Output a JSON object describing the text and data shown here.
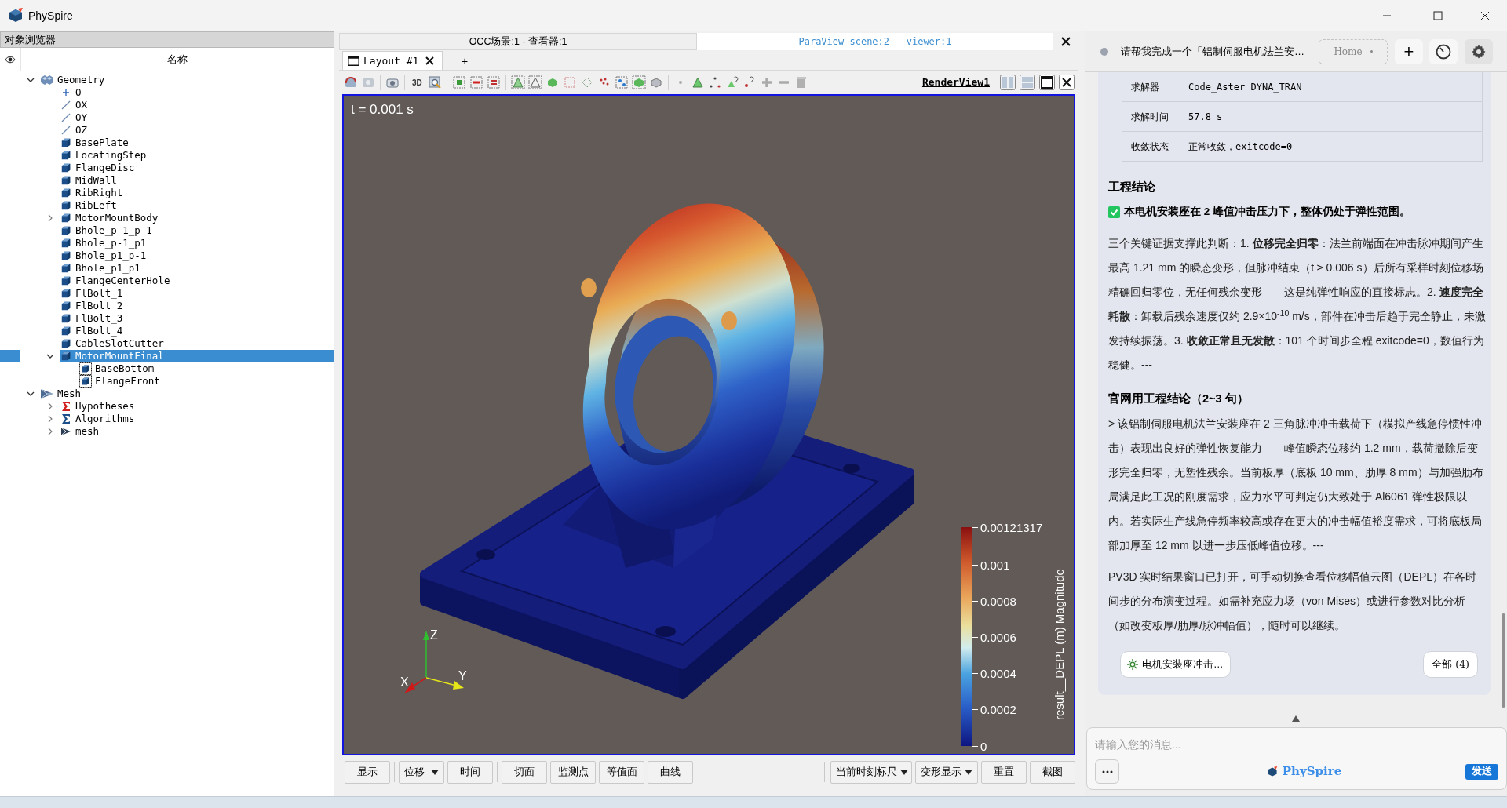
{
  "window": {
    "title": "PhySpire"
  },
  "object_browser": {
    "title": "对象浏览器",
    "column": "名称",
    "tree": [
      {
        "label": "Geometry",
        "kind": "assembly",
        "expanded": true,
        "selected": false,
        "children": [
          {
            "label": "O",
            "kind": "point",
            "selected": false
          },
          {
            "label": "OX",
            "kind": "line",
            "selected": false
          },
          {
            "label": "OY",
            "kind": "line",
            "selected": false
          },
          {
            "label": "OZ",
            "kind": "line",
            "selected": false
          },
          {
            "label": "BasePlate",
            "kind": "solid",
            "selected": false
          },
          {
            "label": "LocatingStep",
            "kind": "solid",
            "selected": false
          },
          {
            "label": "FlangeDisc",
            "kind": "solid",
            "selected": false
          },
          {
            "label": "MidWall",
            "kind": "solid",
            "selected": false
          },
          {
            "label": "RibRight",
            "kind": "solid",
            "selected": false
          },
          {
            "label": "RibLeft",
            "kind": "solid",
            "selected": false
          },
          {
            "label": "MotorMountBody",
            "kind": "solid",
            "expanded": false,
            "selected": false
          },
          {
            "label": "Bhole_p-1_p-1",
            "kind": "solid",
            "selected": false
          },
          {
            "label": "Bhole_p-1_p1",
            "kind": "solid",
            "selected": false
          },
          {
            "label": "Bhole_p1_p-1",
            "kind": "solid",
            "selected": false
          },
          {
            "label": "Bhole_p1_p1",
            "kind": "solid",
            "selected": false
          },
          {
            "label": "FlangeCenterHole",
            "kind": "solid",
            "selected": false
          },
          {
            "label": "FlBolt_1",
            "kind": "solid",
            "selected": false
          },
          {
            "label": "FlBolt_2",
            "kind": "solid",
            "selected": false
          },
          {
            "label": "FlBolt_3",
            "kind": "solid",
            "selected": false
          },
          {
            "label": "FlBolt_4",
            "kind": "solid",
            "selected": false
          },
          {
            "label": "CableSlotCutter",
            "kind": "solid",
            "selected": false
          },
          {
            "label": "MotorMountFinal",
            "kind": "solid",
            "expanded": true,
            "selected": true,
            "children": [
              {
                "label": "BaseBottom",
                "kind": "group",
                "selected": false
              },
              {
                "label": "FlangeFront",
                "kind": "group",
                "selected": false
              }
            ]
          }
        ]
      },
      {
        "label": "Mesh",
        "kind": "mesh",
        "expanded": true,
        "selected": false,
        "children": [
          {
            "label": "Hypotheses",
            "kind": "hypotheses",
            "expanded": false,
            "selected": false
          },
          {
            "label": "Algorithms",
            "kind": "algorithms",
            "expanded": false,
            "selected": false
          },
          {
            "label": "mesh",
            "kind": "submesh",
            "expanded": false,
            "selected": false
          }
        ]
      }
    ]
  },
  "viewer_tabs": [
    {
      "label": "OCC场景:1 - 查看器:1",
      "selected": false
    },
    {
      "label": "ParaView scene:2 - viewer:1",
      "selected": true
    }
  ],
  "layout_tabs": [
    {
      "label": "Layout #1",
      "selected": true
    }
  ],
  "add_tab": "+",
  "toolbar": {
    "three_d": "3D",
    "view_name": "RenderView1"
  },
  "render_view": {
    "time_label": "t = 0.001 s",
    "axes": [
      "X",
      "Y",
      "Z"
    ],
    "color_legend": {
      "title": "result__DEPL (m) Magnitude",
      "ticks": [
        "0.00121317",
        "0.001",
        "0.0008",
        "0.0006",
        "0.0004",
        "0.0002",
        "0"
      ]
    }
  },
  "bottom_toolbar": [
    [
      {
        "label": "显示",
        "kind": "button"
      }
    ],
    [
      {
        "label": "位移",
        "kind": "dropdown"
      },
      {
        "label": "时间",
        "kind": "button"
      }
    ],
    [
      {
        "label": "切面",
        "kind": "button"
      },
      {
        "label": "监测点",
        "kind": "button"
      },
      {
        "label": "等值面",
        "kind": "button"
      },
      {
        "label": "曲线",
        "kind": "button"
      }
    ]
  ],
  "bottom_toolbar_right": [
    {
      "label": "当前时刻标尺",
      "kind": "dropdown"
    },
    {
      "label": "变形显示",
      "kind": "dropdown"
    },
    {
      "label": "重置",
      "kind": "button"
    },
    {
      "label": "截图",
      "kind": "button"
    }
  ],
  "chat": {
    "title": "请帮我完成一个「铝制伺服电机法兰安…",
    "home": "Home",
    "new_button": "+",
    "result_table": [
      [
        "求解器",
        "Code_Aster DYNA_TRAN"
      ],
      [
        "求解时间",
        "57.8 s"
      ],
      [
        "收敛状态",
        "正常收敛，exitcode=0"
      ]
    ],
    "heading": "工程结论",
    "verdict": {
      "text": "本电机安装座在 2 峰值冲击压力下，整体仍处于弹性范围。",
      "checked": true
    },
    "paragraphs": [
      "三个关键证据支撑此判断：1. **位移完全归零**：法兰前端面在冲击脉冲期间产生最高 1.21 mm 的瞬态变形，但脉冲结束（t ≥ 0.006 s）后所有采样时刻位移场精确回归零位，无任何残余变形——这是纯弹性响应的直接标志。2. **速度完全耗散**：卸载后残余速度仅约 2.9×10$^{-10}$ m/s，部件在冲击后趋于完全静止，未激发持续振荡。3. **收敛正常且无发散**：101 个时间步全程 exitcode=0，数值行为稳健。---"
    ],
    "heading2": "官网用工程结论（2~3 句）",
    "paragraphs2": [
      "> 该铝制伺服电机法兰安装座在 2 三角脉冲冲击载荷下（模拟产线急停惯性冲击）表现出良好的弹性恢复能力——峰值瞬态位移约 1.2 mm，载荷撤除后变形完全归零，无塑性残余。当前板厚（底板 10 mm、肋厚 8 mm）与加强肋布局满足此工况的刚度需求，应力水平可判定仍大致处于 Al6061 弹性极限以内。若实际生产线急停频率较高或存在更大的冲击幅值裕度需求，可将底板局部加厚至 12 mm 以进一步压低峰值位移。---",
      "PV3D 实时结果窗口已打开，可手动切换查看位移幅值云图（DEPL）在各时间步的分布演变过程。如需补充应力场（von Mises）或进行参数对比分析（如改变板厚/肋厚/脉冲幅值），随时可以继续。"
    ],
    "chips": [
      "电机安装座冲击…",
      "全部 (4)"
    ],
    "input": {
      "placeholder": "请输入您的消息..."
    },
    "brand": "PhySpire",
    "send_button": "发送"
  }
}
